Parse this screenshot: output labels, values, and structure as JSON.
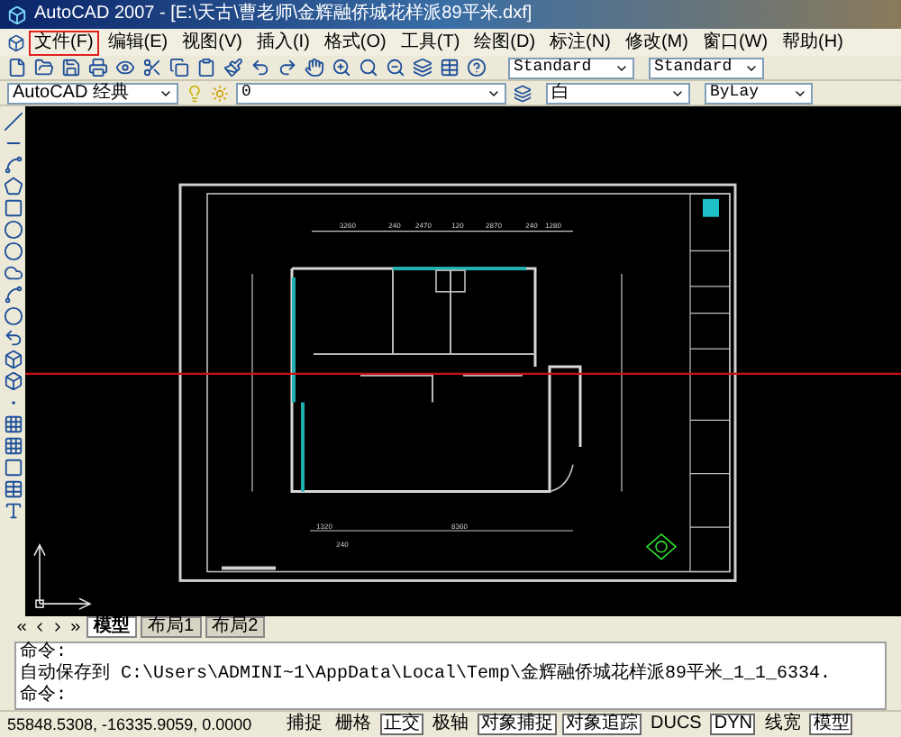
{
  "window": {
    "title": "AutoCAD 2007 - [E:\\天古\\曹老师\\金辉融侨城花样派89平米.dxf]"
  },
  "menu": [
    {
      "label": "文件(F)",
      "selected": true
    },
    {
      "label": "编辑(E)",
      "selected": false
    },
    {
      "label": "视图(V)",
      "selected": false
    },
    {
      "label": "插入(I)",
      "selected": false
    },
    {
      "label": "格式(O)",
      "selected": false
    },
    {
      "label": "工具(T)",
      "selected": false
    },
    {
      "label": "绘图(D)",
      "selected": false
    },
    {
      "label": "标注(N)",
      "selected": false
    },
    {
      "label": "修改(M)",
      "selected": false
    },
    {
      "label": "窗口(W)",
      "selected": false
    },
    {
      "label": "帮助(H)",
      "selected": false
    }
  ],
  "toolbar": {
    "text_style": "Standard",
    "dim_style": "Standard",
    "workspace": "AutoCAD 经典",
    "layer": "0",
    "color_property": "白",
    "linetype": "ByLay"
  },
  "drawing": {
    "top_dimensions": [
      "3260",
      "240",
      "2470",
      "120",
      "2870",
      "240",
      "1280"
    ],
    "bottom_dimensions": [
      "1320",
      "8360",
      "240"
    ]
  },
  "layout_tabs": [
    {
      "label": "模型",
      "selected": true
    },
    {
      "label": "布局1",
      "selected": false
    },
    {
      "label": "布局2",
      "selected": false
    }
  ],
  "command_lines": [
    "命令:",
    "自动保存到 C:\\Users\\ADMINI~1\\AppData\\Local\\Temp\\金辉融侨城花样派89平米_1_1_6334.",
    "命令:"
  ],
  "status_bar": {
    "coordinates": "55848.5308, -16335.9059, 0.0000",
    "toggles": [
      {
        "label": "捕捉",
        "on": false
      },
      {
        "label": "栅格",
        "on": false
      },
      {
        "label": "正交",
        "on": true
      },
      {
        "label": "极轴",
        "on": false
      },
      {
        "label": "对象捕捉",
        "on": true
      },
      {
        "label": "对象追踪",
        "on": true
      },
      {
        "label": "DUCS",
        "on": false
      },
      {
        "label": "DYN",
        "on": true
      },
      {
        "label": "线宽",
        "on": false
      },
      {
        "label": "模型",
        "on": true
      }
    ]
  }
}
